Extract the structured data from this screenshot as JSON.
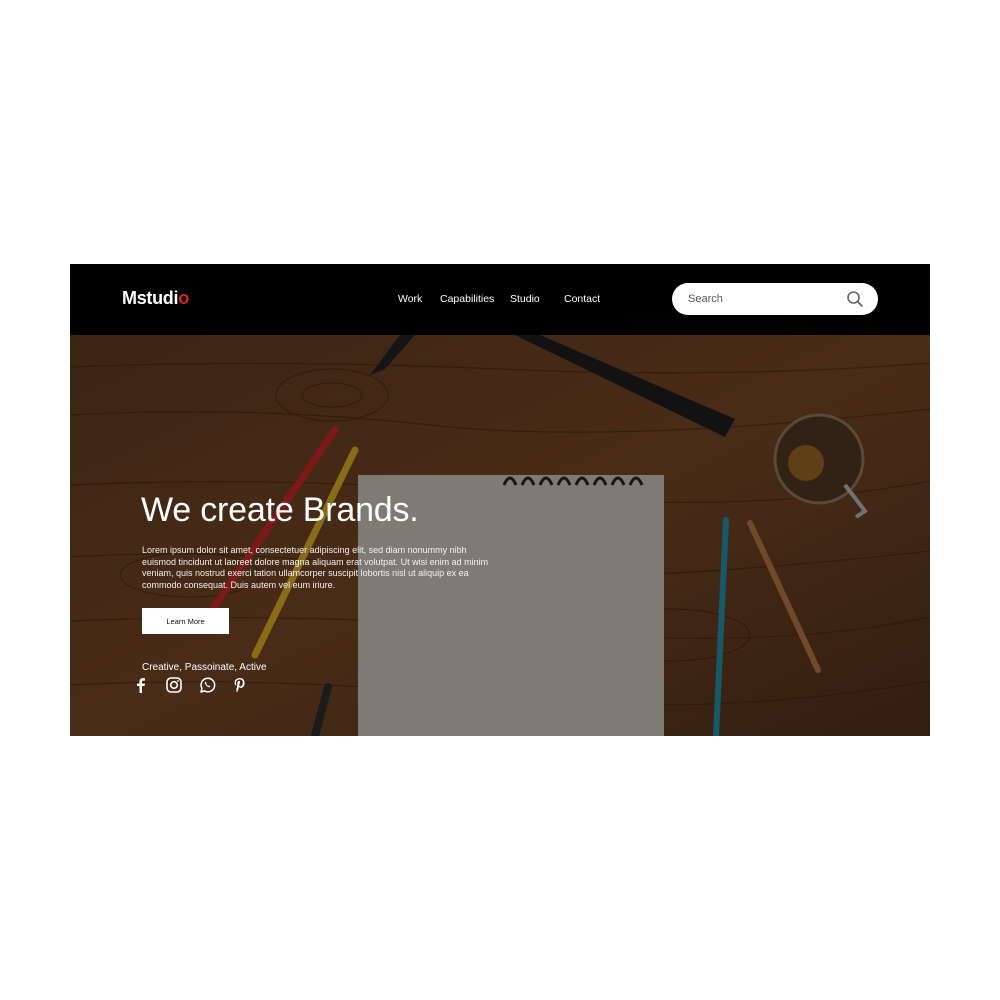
{
  "brand": {
    "name": "Mstudi",
    "accent_letter": "o",
    "accent_color": "#e0241b"
  },
  "nav": {
    "items": [
      {
        "label": "Work"
      },
      {
        "label": "Capabilities"
      },
      {
        "label": "Studio"
      },
      {
        "label": "Contact"
      }
    ]
  },
  "search": {
    "placeholder": "Search",
    "value": "",
    "icon": "search-icon"
  },
  "hero": {
    "headline": "We create Brands.",
    "body": "Lorem ipsum dolor sit amet, consectetuer adipiscing elit, sed diam nonummy nibh euismod tincidunt ut laoreet dolore magna aliquam erat volutpat. Ut wisi enim ad minim veniam, quis nostrud exerci tation ullamcorper suscipit lobortis nisl ut aliquip ex ea commodo consequat. Duis autem vel eum iriure.",
    "button_label": "Learn More",
    "tagline": "Creative, Passoinate, Active"
  },
  "social_icons": [
    "facebook-icon",
    "instagram-icon",
    "whatsapp-icon",
    "pinterest-icon"
  ]
}
